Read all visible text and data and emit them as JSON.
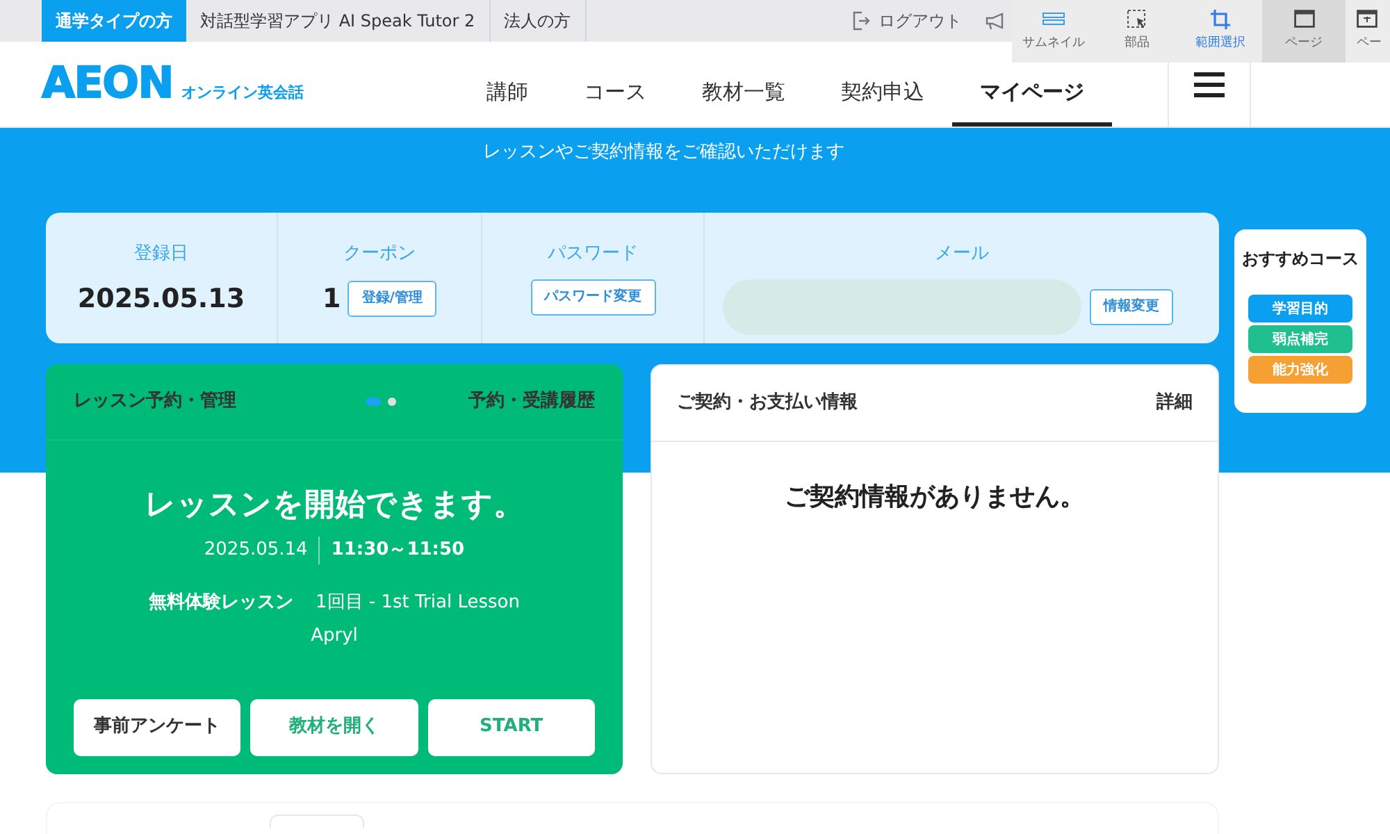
{
  "top_tabs": [
    {
      "label": "通学タイプの方",
      "selected": true
    },
    {
      "label": "対話型学習アプリ AI Speak Tutor 2",
      "selected": false
    },
    {
      "label": "法人の方",
      "selected": false
    }
  ],
  "logout": "ログアウト",
  "toolbar": [
    {
      "label": "サムネイル",
      "kind": "thumbnails",
      "selected": false,
      "hovered": false
    },
    {
      "label": "部品",
      "kind": "select",
      "selected": false,
      "hovered": false
    },
    {
      "label": "範囲選択",
      "kind": "crop",
      "selected": true,
      "hovered": false
    },
    {
      "label": "ページ",
      "kind": "page",
      "selected": false,
      "hovered": true
    },
    {
      "label": "ペー",
      "kind": "page-alt",
      "selected": false,
      "hovered": false
    }
  ],
  "logo": {
    "wordmark": "AEON",
    "subtitle": "オンライン英会話"
  },
  "nav": [
    {
      "label": "講師",
      "selected": false
    },
    {
      "label": "コース",
      "selected": false
    },
    {
      "label": "教材一覧",
      "selected": false
    },
    {
      "label": "契約申込",
      "selected": false
    },
    {
      "label": "マイページ",
      "selected": true
    }
  ],
  "banner_text": "レッスンやご契約情報をご確認いただけます",
  "account": {
    "registered": {
      "label": "登録日",
      "value": "2025.05.13"
    },
    "coupon": {
      "label": "クーポン",
      "count": "1",
      "button": "登録/管理"
    },
    "password": {
      "label": "パスワード",
      "button": "パスワード変更"
    },
    "mail": {
      "label": "メール",
      "button": "情報変更"
    }
  },
  "lesson_card": {
    "title": "レッスン予約・管理",
    "pager": [
      {
        "selected": true
      },
      {
        "selected": false
      }
    ],
    "link": "予約・受講履歴",
    "headline": "レッスンを開始できます。",
    "date": "2025.05.14",
    "time": "11:30～11:50",
    "type": "無料体験レッスン",
    "lesson": "1回目 - 1st Trial Lesson",
    "teacher": "Apryl",
    "buttons": [
      {
        "label": "事前アンケート",
        "kind": "plain"
      },
      {
        "label": "教材を開く",
        "kind": "accent"
      },
      {
        "label": "START",
        "kind": "accent"
      }
    ]
  },
  "contract_card": {
    "title": "ご契約・お支払い情報",
    "link": "詳細",
    "message": "ご契約情報がありません。"
  },
  "recommend": {
    "title": "おすすめコース",
    "items": [
      {
        "label": "学習目的",
        "color": "#0a9ff0"
      },
      {
        "label": "弱点補完",
        "color": "#1fbf8f"
      },
      {
        "label": "能力強化",
        "color": "#f6a033"
      }
    ]
  }
}
